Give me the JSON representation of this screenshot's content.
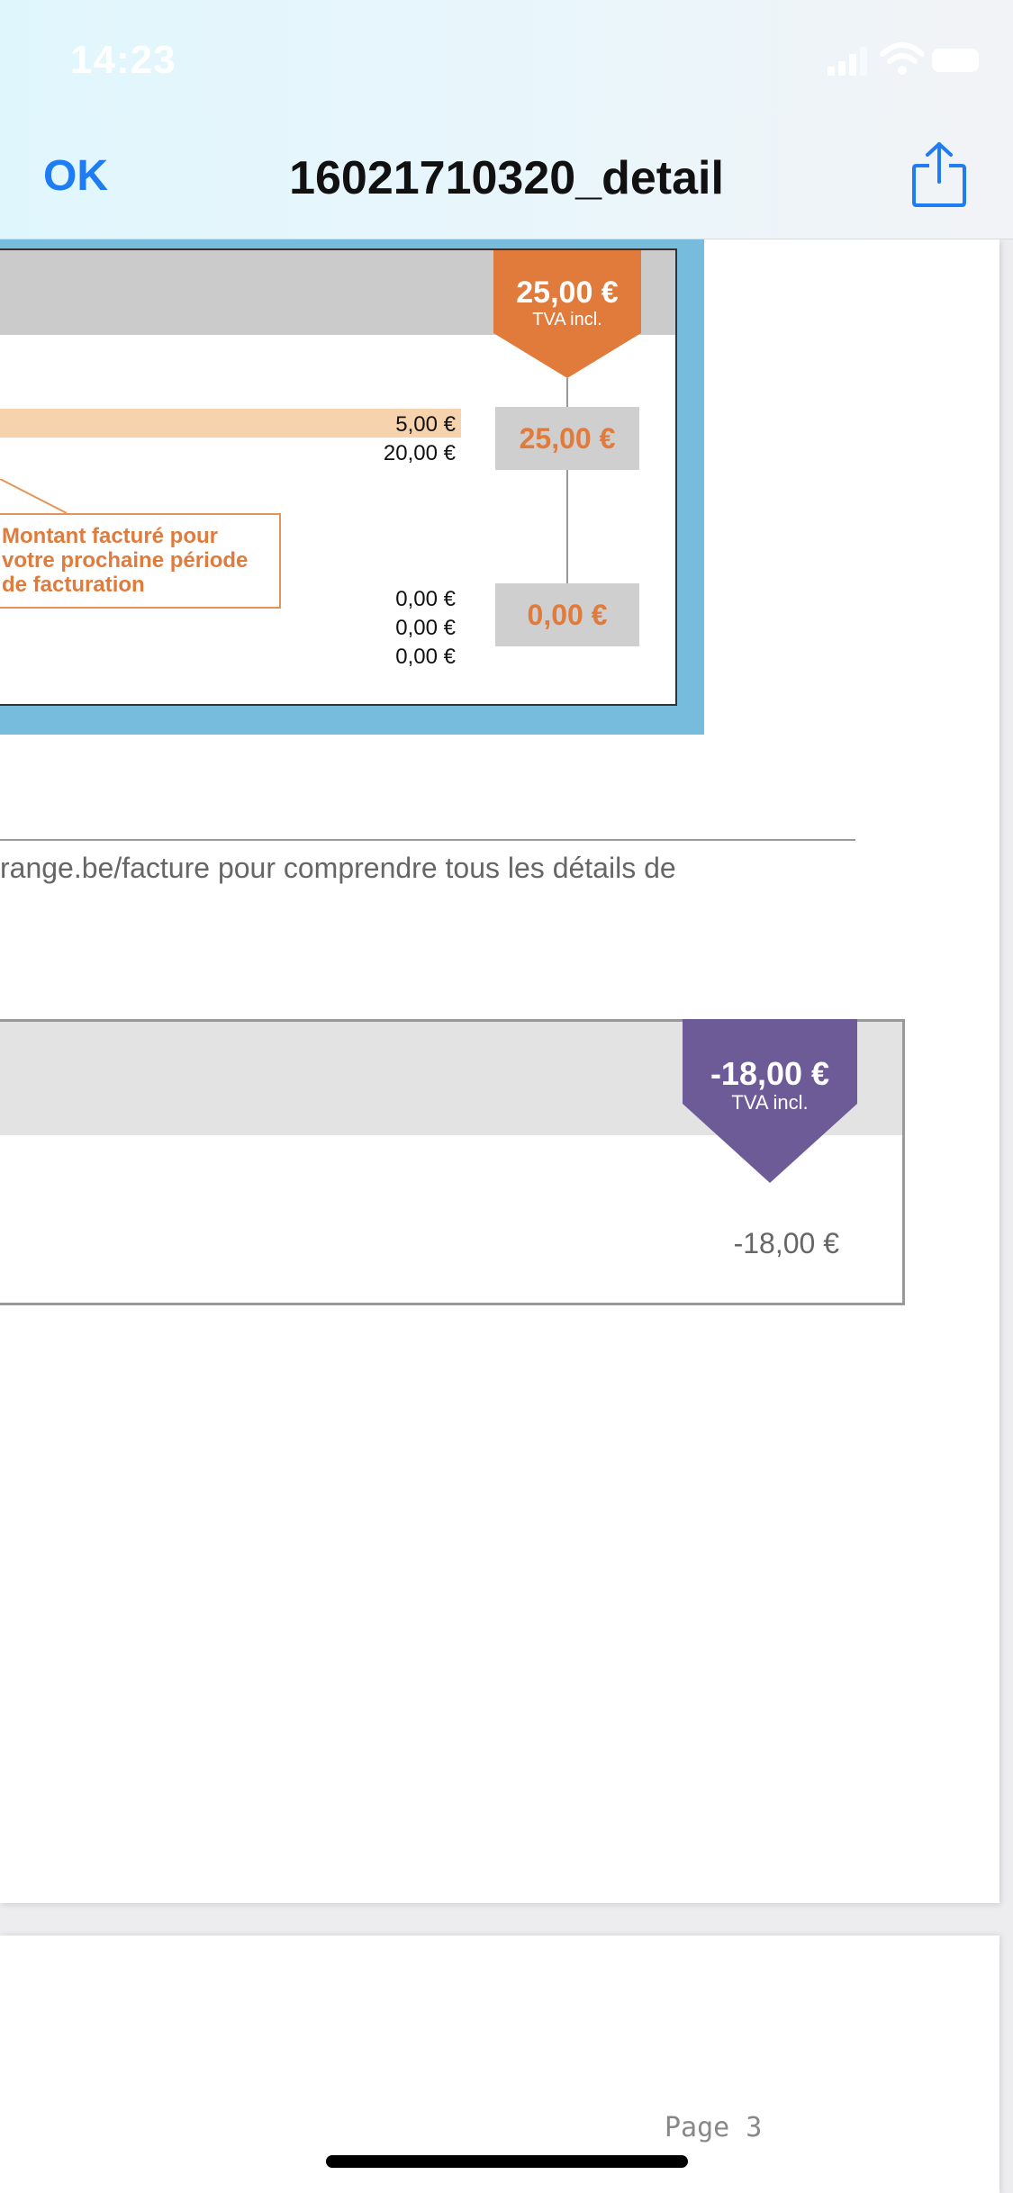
{
  "status_bar": {
    "time": "14:23"
  },
  "nav": {
    "ok_label": "OK",
    "title": "16021710320_detail",
    "share_icon": "share-icon"
  },
  "summary": {
    "total_amount": "25,00 €",
    "total_note": "TVA incl.",
    "lines_group1": [
      "5,00 €",
      "20,00 €"
    ],
    "group1_total": "25,00 €",
    "callout": [
      "Montant facturé pour",
      "votre prochaine période",
      "de facturation"
    ],
    "lines_group2": [
      "0,00 €",
      "0,00 €",
      "0,00 €"
    ],
    "group2_total": "0,00 €",
    "colors": {
      "accent_orange": "#e07b3c",
      "frame_blue": "#78bcdd"
    }
  },
  "info": {
    "text": "range.be/facture pour comprendre tous les détails de"
  },
  "discount": {
    "tag_amount": "-18,00 €",
    "tag_note": "TVA incl.",
    "line_amount": "-18,00 €",
    "colors": {
      "accent_purple": "#6d5b98"
    }
  },
  "footer": {
    "page_label": "Page 3"
  }
}
